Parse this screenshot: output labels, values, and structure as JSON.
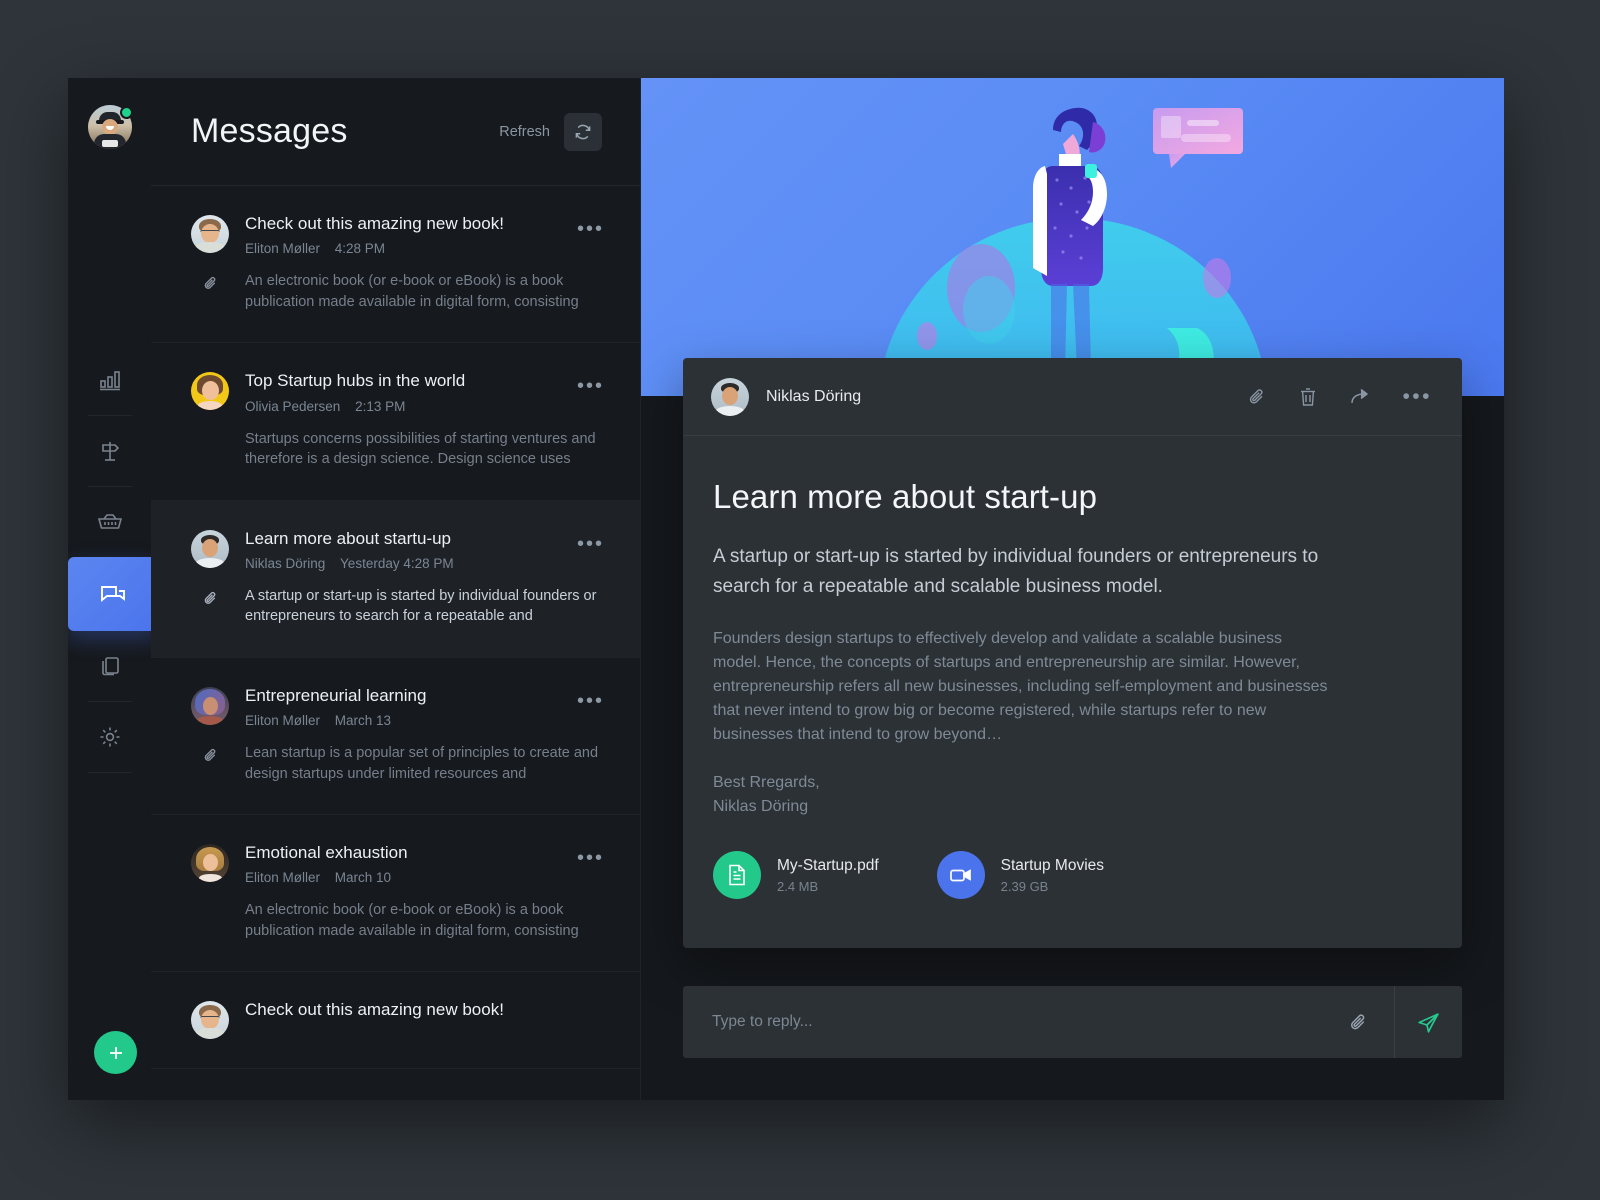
{
  "colors": {
    "accent_blue": "#4b74ec",
    "hero_blue": "#5b8df5",
    "accent_green": "#23c98a",
    "send_green": "#25c88d",
    "panel": "#2c3136",
    "list_bg": "#16191d",
    "page_bg": "#2e343a"
  },
  "rail": {
    "avatar_name": "user-avatar",
    "status": "online",
    "items": [
      {
        "name": "analytics",
        "icon": "bar-chart-icon",
        "active": false
      },
      {
        "name": "directions",
        "icon": "signpost-icon",
        "active": false
      },
      {
        "name": "orders",
        "icon": "basket-icon",
        "active": false
      },
      {
        "name": "messages",
        "icon": "chat-bubbles-icon",
        "active": true
      },
      {
        "name": "documents",
        "icon": "documents-icon",
        "active": false
      },
      {
        "name": "settings",
        "icon": "gear-icon",
        "active": false
      }
    ],
    "fab_label": "+"
  },
  "list": {
    "title": "Messages",
    "refresh_label": "Refresh",
    "refresh_icon": "refresh-icon",
    "messages": [
      {
        "subject": "Check out this amazing new book!",
        "sender": "Eliton Møller",
        "time": "4:28 PM",
        "preview": "An electronic book (or e-book or eBook) is a book publication made available in digital form, consisting of…",
        "has_attachment": true,
        "selected": false,
        "avatar": "man-glasses"
      },
      {
        "subject": "Top Startup hubs in the world",
        "sender": "Olivia Pedersen",
        "time": "2:13 PM",
        "preview": "Startups concerns possibilities of starting ventures and therefore is a design science. Design science uses design…",
        "has_attachment": false,
        "selected": false,
        "avatar": "woman-yellow"
      },
      {
        "subject": "Learn more about startu-up",
        "sender": "Niklas Döring",
        "time": "Yesterday 4:28 PM",
        "preview": "A startup or start-up is started by individual founders or entrepreneurs to search for a repeatable and scalable…",
        "has_attachment": true,
        "selected": true,
        "avatar": "man-short-hair"
      },
      {
        "subject": "Entrepreneurial learning",
        "sender": "Eliton Møller",
        "time": "March 13",
        "preview": "Lean startup is a popular set of principles to create and design startups under limited resources and tremendous…",
        "has_attachment": true,
        "selected": false,
        "avatar": "woman-blue-hair"
      },
      {
        "subject": "Emotional exhaustion",
        "sender": "Eliton Møller",
        "time": "March 10",
        "preview": "An electronic book (or e-book or eBook) is a book publication made available in digital form, consisting of…",
        "has_attachment": false,
        "selected": false,
        "avatar": "woman-blonde"
      },
      {
        "subject": "Check out this amazing new book!",
        "sender": "",
        "time": "",
        "preview": "",
        "has_attachment": false,
        "selected": false,
        "avatar": "man-glasses"
      }
    ]
  },
  "detail": {
    "sender": "Niklas Döring",
    "actions": [
      {
        "name": "attach",
        "icon": "paperclip-icon"
      },
      {
        "name": "delete",
        "icon": "trash-icon"
      },
      {
        "name": "forward",
        "icon": "forward-arrow-icon"
      },
      {
        "name": "more",
        "icon": "more-dots-icon",
        "label": "•••"
      }
    ],
    "title": "Learn more about start-up",
    "lead": "A startup or start-up is started by individual founders or entrepreneurs to search for a repeatable and scalable business model.",
    "paragraph": "Founders design startups to effectively develop and validate a scalable business model. Hence, the concepts of startups and entrepreneurship are similar. However, entrepreneurship refers all new businesses, including self-employment and businesses that never intend to grow big or become registered, while startups refer to new businesses that intend to grow beyond…",
    "signoff": "Best Rregards,",
    "signature": "Niklas Döring",
    "attachments": [
      {
        "name": "My-Startup.pdf",
        "size": "2.4 MB",
        "icon": "pdf-document-icon",
        "color": "#23c98a"
      },
      {
        "name": "Startup Movies",
        "size": "2.39 GB",
        "icon": "video-camera-icon",
        "color": "#4b74ec"
      }
    ]
  },
  "reply": {
    "placeholder": "Type to reply...",
    "value": "",
    "attach_icon": "paperclip-icon",
    "send_icon": "send-plane-icon"
  },
  "hero": {
    "illustration": "person-with-chat-bubble-illustration"
  }
}
